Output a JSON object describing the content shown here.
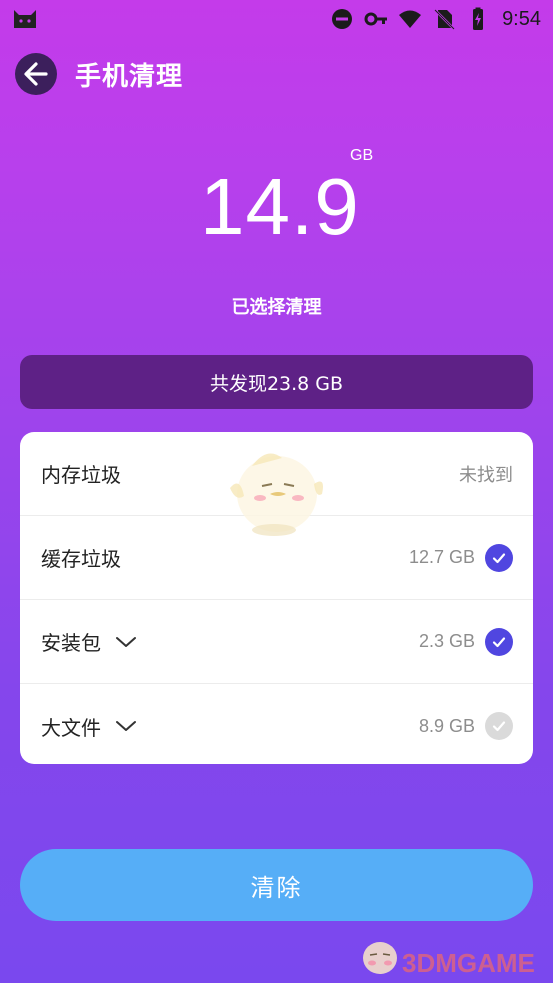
{
  "status_bar": {
    "time": "9:54",
    "icons": [
      "cat-app-icon",
      "dnd-icon",
      "key-icon",
      "wifi-icon",
      "no-sim-icon",
      "battery-charging-icon"
    ]
  },
  "header": {
    "title": "手机清理",
    "back_icon": "arrow-left-icon"
  },
  "summary": {
    "amount": "14.9",
    "unit": "GB",
    "selected_label": "已选择清理",
    "found_text": "共发现23.8 GB"
  },
  "items": [
    {
      "label": "内存垃圾",
      "expandable": false,
      "value": "",
      "status": "未找到",
      "checked": null
    },
    {
      "label": "缓存垃圾",
      "expandable": false,
      "value": "12.7 GB",
      "status": "",
      "checked": true
    },
    {
      "label": "安装包",
      "expandable": true,
      "value": "2.3 GB",
      "status": "",
      "checked": true
    },
    {
      "label": "大文件",
      "expandable": true,
      "value": "8.9 GB",
      "status": "",
      "checked": false
    }
  ],
  "clear_button": {
    "label": "清除"
  },
  "watermark": {
    "text": "3DMGAME"
  },
  "colors": {
    "background_top": "#c43bea",
    "background_bottom": "#7a48ee",
    "found_bar": "#5e2186",
    "check_on": "#5046e0",
    "check_off": "#dadada",
    "clear_button": "#56aef7"
  }
}
